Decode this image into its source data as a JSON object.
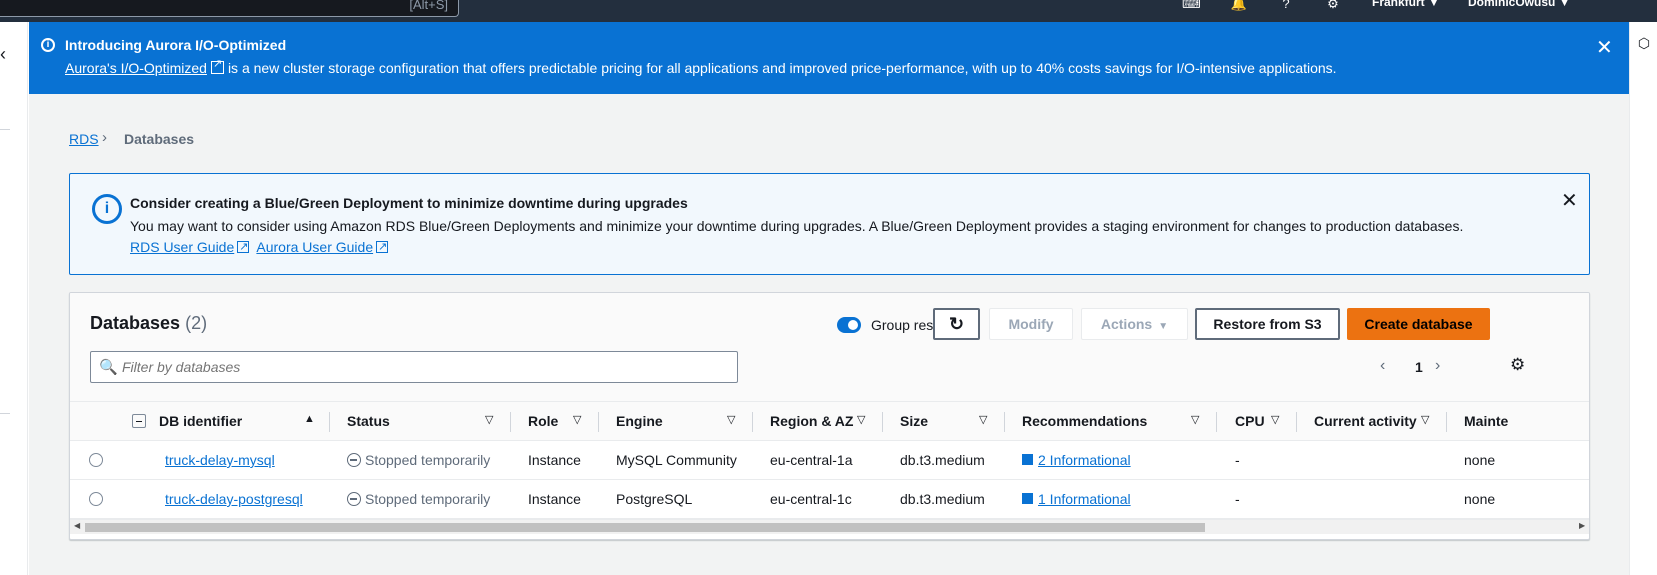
{
  "topnav": {
    "search_shortcut": "[Alt+S]",
    "icons": [
      "cloudshell-icon",
      "bell-icon",
      "help-icon",
      "settings-icon"
    ],
    "region": "Frankfurt ▼",
    "user": "DominicOwusu ▼"
  },
  "flash": {
    "title": "Introducing Aurora I/O-Optimized",
    "link": "Aurora's I/O-Optimized",
    "message": "is a new cluster storage configuration that offers predictable pricing for all applications and improved price-performance, with up to 40% costs savings for I/O-intensive applications."
  },
  "breadcrumb": {
    "root": "RDS",
    "current": "Databases"
  },
  "alert": {
    "title": "Consider creating a Blue/Green Deployment to minimize downtime during upgrades",
    "message": "You may want to consider using Amazon RDS Blue/Green Deployments and minimize your downtime during upgrades. A Blue/Green Deployment provides a staging environment for changes to production databases.",
    "link1": "RDS User Guide",
    "link2": "Aurora User Guide"
  },
  "databases": {
    "title": "Databases",
    "count": "(2)",
    "group_resources_label": "Group resources",
    "group_resources_on": true,
    "buttons": {
      "modify": "Modify",
      "actions": "Actions",
      "restore": "Restore from S3",
      "create": "Create database"
    },
    "filter_placeholder": "Filter by databases",
    "page": "1",
    "columns": [
      "DB identifier",
      "Status",
      "Role",
      "Engine",
      "Region & AZ",
      "Size",
      "Recommendations",
      "CPU",
      "Current activity",
      "Mainte"
    ],
    "rows": [
      {
        "id": "truck-delay-mysql",
        "status": "Stopped temporarily",
        "role": "Instance",
        "engine": "MySQL Community",
        "region": "eu-central-1a",
        "size": "db.t3.medium",
        "recommendations": "2 Informational",
        "cpu": "-",
        "activity": "",
        "maintenance": "none"
      },
      {
        "id": "truck-delay-postgresql",
        "status": "Stopped temporarily",
        "role": "Instance",
        "engine": "PostgreSQL",
        "region": "eu-central-1c",
        "size": "db.t3.medium",
        "recommendations": "1 Informational",
        "cpu": "-",
        "activity": "",
        "maintenance": "none"
      }
    ]
  },
  "colors": {
    "flash_bg": "#0972d3",
    "primary_button": "#ec7211",
    "link": "#0972d3",
    "topnav": "#232f3e"
  }
}
